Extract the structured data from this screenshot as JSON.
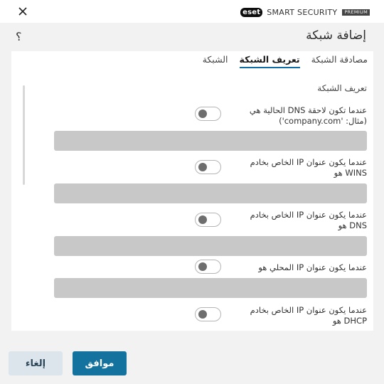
{
  "window": {
    "brand_logo": "eset",
    "brand_name": "SMART SECURITY",
    "brand_edition": "PREMIUM"
  },
  "header": {
    "title": "إضافة شبكة",
    "help": "؟"
  },
  "tabs": [
    {
      "label": "الشبكة",
      "active": false
    },
    {
      "label": "تعريف الشبكة",
      "active": true
    },
    {
      "label": "مصادقة الشبكة",
      "active": false
    }
  ],
  "section": {
    "heading": "تعريف الشبكة"
  },
  "fields": [
    {
      "label": "عندما تكون لاحقة DNS الحالية هي (مثال: 'company.com')",
      "enabled": false,
      "value": ""
    },
    {
      "label": "عندما يكون عنوان IP الخاص بخادم WINS هو",
      "enabled": false,
      "value": ""
    },
    {
      "label": "عندما يكون عنوان IP الخاص بخادم DNS هو",
      "enabled": false,
      "value": ""
    },
    {
      "label": "عندما يكون عنوان IP المحلي هو",
      "enabled": false,
      "value": ""
    },
    {
      "label": "عندما يكون عنوان IP الخاص بخادم DHCP هو",
      "enabled": false
    }
  ],
  "buttons": {
    "ok": "موافق",
    "cancel": "إلغاء"
  },
  "colors": {
    "accent": "#14729f",
    "cancel_bg": "#dde5ec",
    "input_bg": "#c8c8c8"
  }
}
